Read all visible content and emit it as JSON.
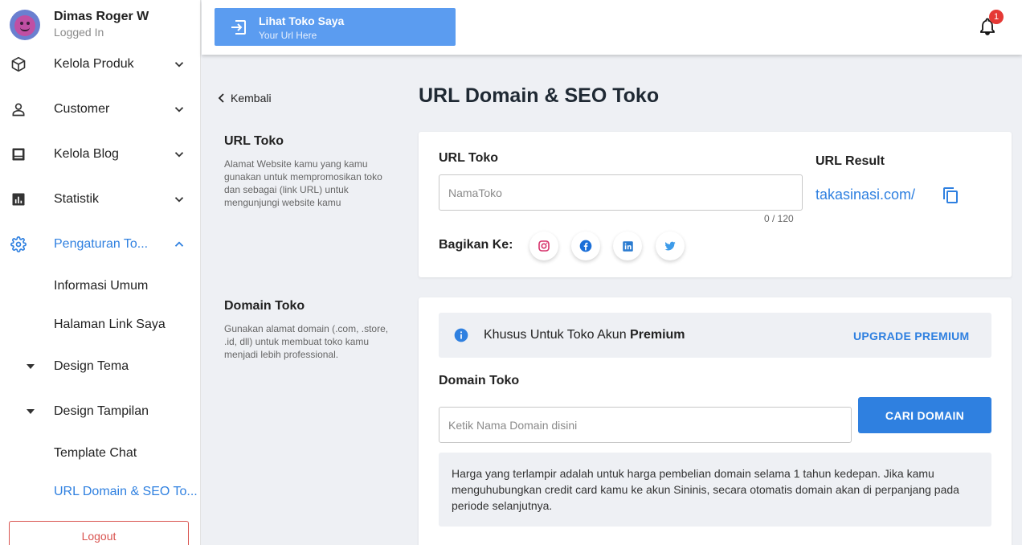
{
  "profile": {
    "name": "Dimas Roger W",
    "status": "Logged In"
  },
  "sidebar": {
    "items": [
      {
        "label": "Kelola Produk",
        "icon": "package-icon"
      },
      {
        "label": "Customer",
        "icon": "person-icon"
      },
      {
        "label": "Kelola Blog",
        "icon": "blog-icon"
      },
      {
        "label": "Statistik",
        "icon": "chart-icon"
      },
      {
        "label": "Pengaturan To...",
        "icon": "gear-icon"
      }
    ],
    "subitems": [
      {
        "label": "Informasi Umum"
      },
      {
        "label": "Halaman Link Saya"
      },
      {
        "label": "Design Tema"
      },
      {
        "label": "Design Tampilan"
      },
      {
        "label": "Template Chat"
      },
      {
        "label": "URL Domain & SEO To..."
      }
    ],
    "logout": "Logout"
  },
  "topbar": {
    "visit_title": "Lihat Toko Saya",
    "visit_sub": "Your Url Here",
    "notification_count": "1"
  },
  "main": {
    "back": "Kembali",
    "title": "URL Domain & SEO Toko",
    "url_section": {
      "title": "URL Toko",
      "desc": "Alamat Website kamu yang kamu gunakan untuk mempromosikan toko dan sebagai (link URL) untuk mengunjungi website kamu",
      "field_label": "URL Toko",
      "placeholder": "NamaToko",
      "counter": "0 / 120",
      "result_label": "URL Result",
      "result_url": "takasinasi.com/",
      "share_label": "Bagikan Ke:"
    },
    "domain_section": {
      "title": "Domain Toko",
      "desc": "Gunakan alamat domain (.com, .store, .id, dll) untuk membuat toko kamu menjadi lebih professional.",
      "premium_text": "Khusus Untuk Toko Akun ",
      "premium_bold": "Premium",
      "upgrade": "UPGRADE PREMIUM",
      "field_label": "Domain Toko",
      "placeholder": "Ketik Nama Domain disini",
      "search_button": "CARI DOMAIN",
      "note": "Harga yang terlampir adalah untuk harga pembelian domain selama 1 tahun kedepan. Jika kamu menguhubungkan credit card kamu ke akun Sininis, secara otomatis domain akan di perpanjang pada periode selanjutnya."
    }
  },
  "colors": {
    "accent": "#2f80e0",
    "visit_button": "#5b9cf0",
    "logout": "#d9534f",
    "badge": "#e53935"
  }
}
